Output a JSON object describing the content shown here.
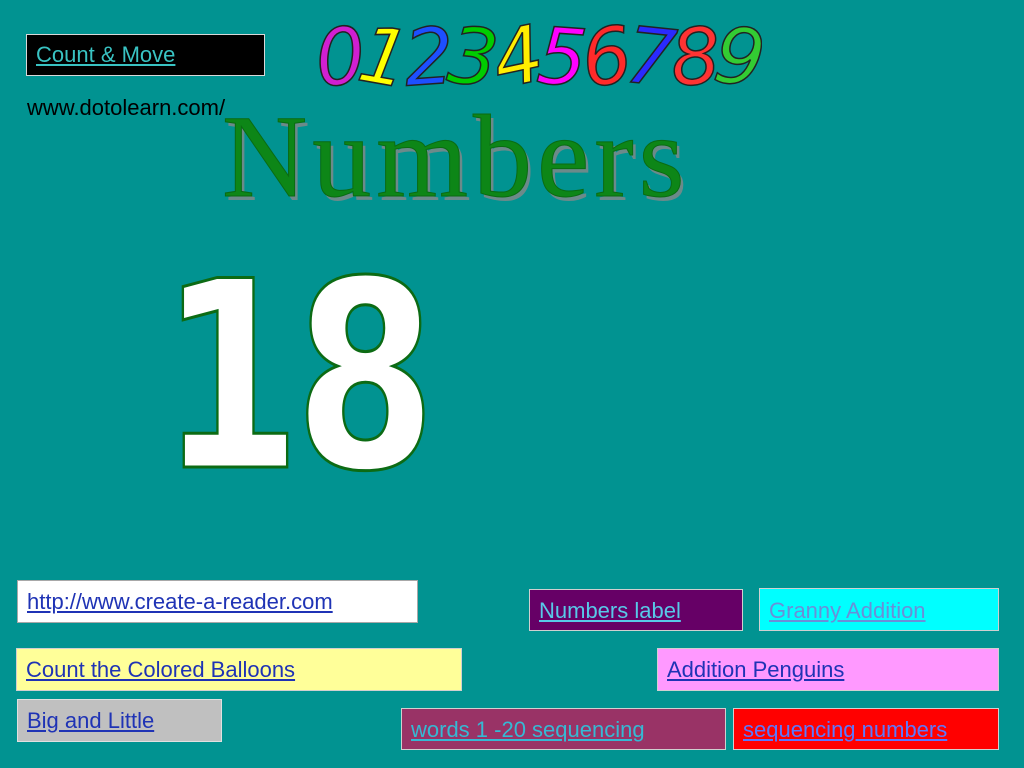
{
  "links": {
    "count_move": "Count & Move",
    "create_reader": "http://www.create-a-reader.com",
    "numbers_label": "Numbers label",
    "granny_addition": "Granny Addition",
    "count_balloons": " Count the Colored Balloons",
    "addition_penguins": "Addition Penguins",
    "big_little": "Big and Little",
    "words_sequencing": "words 1 -20 sequencing",
    "sequencing_numbers": "sequencing numbers"
  },
  "site_url": "www.dotolearn.com/",
  "title": "Numbers",
  "big_number": "18",
  "banner": {
    "digits": [
      "0",
      "1",
      "2",
      "3",
      "4",
      "5",
      "6",
      "7",
      "8",
      "9"
    ],
    "colors": [
      "#d11fd1",
      "#ffff00",
      "#1d4fff",
      "#00cc00",
      "#ffee00",
      "#ff00ff",
      "#ff2a2a",
      "#2a2aff",
      "#ff3333",
      "#33cc33"
    ]
  },
  "colors": {
    "background": "#019391",
    "title": "#0d8617",
    "big_number_fill": "#ffffff"
  }
}
